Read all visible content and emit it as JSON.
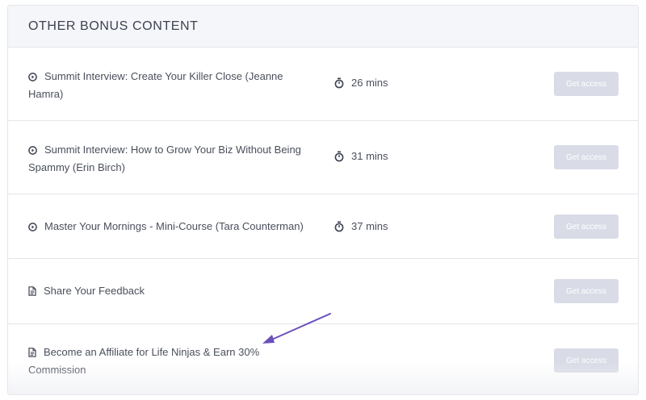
{
  "section": {
    "title": "OTHER BONUS CONTENT"
  },
  "colors": {
    "button_bg": "#d9dce7",
    "arrow": "#6b4fbb",
    "header_bg": "#f5f6fa"
  },
  "items": [
    {
      "icon": "play-circle-icon",
      "title": "Summit Interview: Create Your Killer Close (Jeanne Hamra)",
      "duration": "26 mins",
      "button": "Get access"
    },
    {
      "icon": "play-circle-icon",
      "title": "Summit Interview: How to Grow Your Biz Without Being Spammy (Erin Birch)",
      "duration": "31 mins",
      "button": "Get access"
    },
    {
      "icon": "play-circle-icon",
      "title": "Master Your Mornings - Mini-Course (Tara Counterman)",
      "duration": "37 mins",
      "button": "Get access"
    },
    {
      "icon": "document-icon",
      "title": "Share Your Feedback",
      "duration": "",
      "button": "Get access"
    },
    {
      "icon": "document-icon",
      "title": "Become an Affiliate for Life Ninjas & Earn 30% Commission",
      "duration": "",
      "button": "Get access"
    }
  ]
}
